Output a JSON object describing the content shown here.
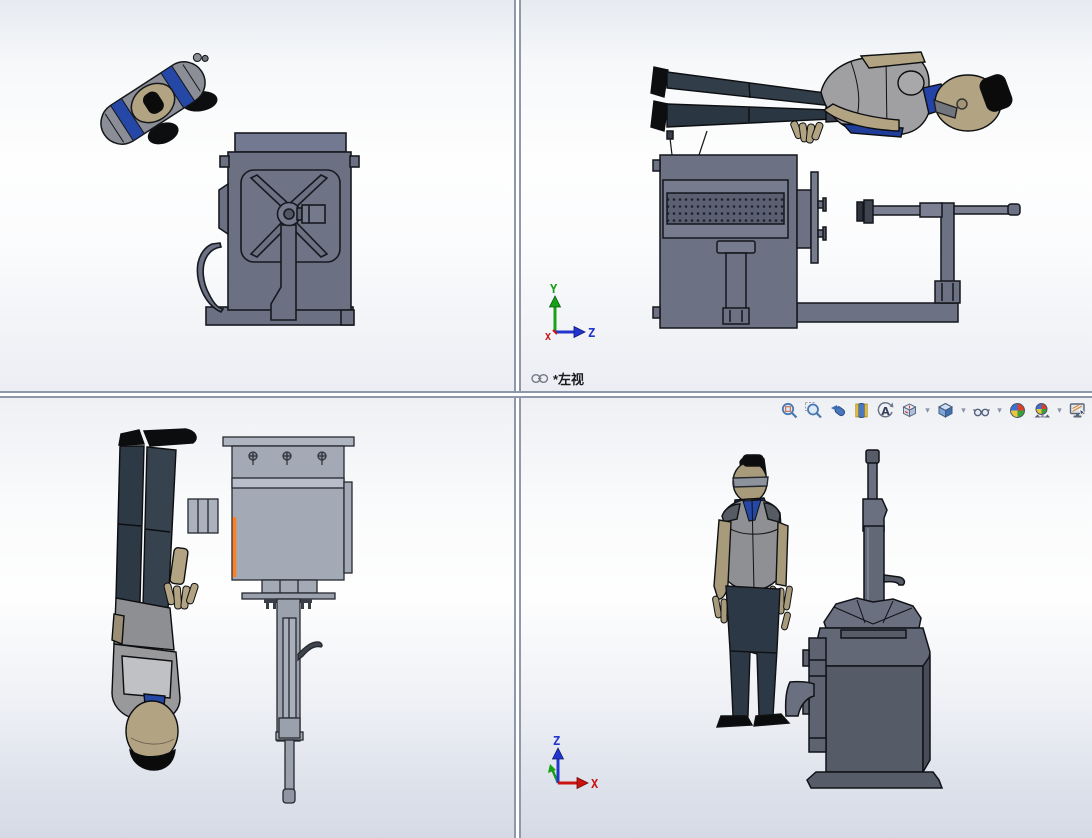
{
  "viewport_labels": {
    "top_right": "*左视"
  },
  "triads": {
    "top_right": {
      "up_axis": "Y",
      "right_axis": "Z",
      "depth_axis": "X"
    },
    "bottom_right": {
      "up_axis": "Z",
      "right_axis": "X"
    }
  },
  "hud_toolbar": {
    "caret_glyph": "▾",
    "icons": [
      {
        "name": "zoom-to-fit"
      },
      {
        "name": "zoom-to-area"
      },
      {
        "name": "previous-view"
      },
      {
        "name": "section-view"
      },
      {
        "name": "3d-drawing-view",
        "glyph": "A"
      },
      {
        "name": "view-orientation",
        "has_dropdown": true
      },
      {
        "name": "display-style",
        "has_dropdown": true
      },
      {
        "name": "hide-show-items",
        "has_dropdown": true
      },
      {
        "name": "edit-appearance"
      },
      {
        "name": "apply-scene",
        "has_dropdown": true
      },
      {
        "name": "view-settings"
      }
    ]
  },
  "selection": {
    "highlight_color": "#ff7f1f"
  },
  "axis_colors": {
    "x": "#cc1111",
    "y": "#18a018",
    "z": "#2335cf"
  },
  "model_colors": {
    "machine_body": "#6b7183",
    "machine_top_view": "#a3a9b5",
    "machine_dark": "#565b68",
    "person_skin": "#ab9e7e",
    "person_vest": "#97979b",
    "person_pants": "#2e3945",
    "person_collar": "#2141a1",
    "person_hair": "#0c0c0c"
  }
}
